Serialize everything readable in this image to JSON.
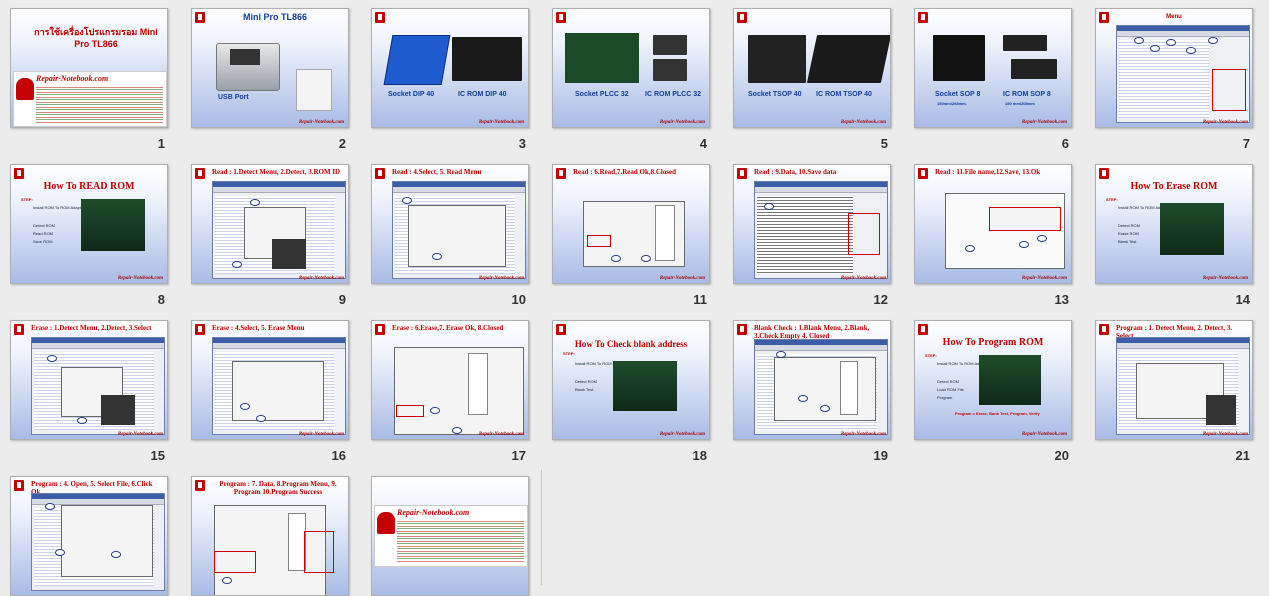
{
  "slides": [
    {
      "num": "1",
      "title_th": "การใช้เครื่องโปรแกรมรอม Mini Pro TL866",
      "site": "Repair-Notebook.com"
    },
    {
      "num": "2",
      "title": "Mini Pro TL866",
      "usb": "USB Port"
    },
    {
      "num": "3",
      "left": "Socket DIP 40",
      "right": "IC ROM DIP 40"
    },
    {
      "num": "4",
      "left": "Socket PLCC 32",
      "right": "IC ROM PLCC 32"
    },
    {
      "num": "5",
      "left": "Socket TSOP 40",
      "right": "IC ROM TSOP 40"
    },
    {
      "num": "6",
      "left": "Socket SOP 8",
      "right": "IC ROM SOP 8",
      "sub_left": "150mm/208mm.",
      "sub_right": "150 mm/208mm"
    },
    {
      "num": "7",
      "title": "Menu"
    },
    {
      "num": "8",
      "title": "How To READ  ROM",
      "step": "STEP:",
      "items": [
        "Install ROM To ROM Adapter",
        "Detect ROM",
        "Read ROM",
        "Save ROM"
      ]
    },
    {
      "num": "9",
      "title": "Read : 1.Detect Menu, 2.Detect, 3.ROM ID"
    },
    {
      "num": "10",
      "title": "Read : 4.Select, 5. Read Menu"
    },
    {
      "num": "11",
      "title": "Read : 6.Read,7.Read Ok,8.Closed"
    },
    {
      "num": "12",
      "title": "Read : 9.Data, 10.Save data"
    },
    {
      "num": "13",
      "title": "Read : 11.File name,12.Save, 13.Ok"
    },
    {
      "num": "14",
      "title": "How To Erase ROM",
      "step": "STEP:",
      "items": [
        "Install ROM To ROM Adapter",
        "Detect ROM",
        "Erase ROM",
        "Blank Test"
      ]
    },
    {
      "num": "15",
      "title": "Erase : 1.Detect Menu, 2.Detect, 3.Select"
    },
    {
      "num": "16",
      "title": "Erase : 4.Select, 5. Erase Menu"
    },
    {
      "num": "17",
      "title": "Erase : 6.Erase,7. Erase Ok, 8.Closed"
    },
    {
      "num": "18",
      "title": "How To Check blank address",
      "step": "STEP:",
      "items": [
        "Install ROM To ROM Adapter",
        "Detect ROM",
        "Blank Test"
      ]
    },
    {
      "num": "19",
      "title": "Blank Check : 1.Blank Menu, 2.Blank, 3.Check Empty 4. Closed"
    },
    {
      "num": "20",
      "title": "How To  Program ROM",
      "step": "STEP:",
      "items": [
        "Install ROM To ROM Adapter",
        "Detect ROM",
        "Load ROM File",
        "Program"
      ],
      "note": "Program = Erase, Bank Test, Program, Verify"
    },
    {
      "num": "21",
      "title": "Program : 1. Detect Menu, 2. Detect, 3. Select"
    },
    {
      "num": "22",
      "title": "Program : 4. Open, 5. Select File, 6.Click Ok"
    },
    {
      "num": "23",
      "title": "Program : 7. Data, 8.Program Menu, 9. Program 10.Program Success"
    },
    {
      "num": "",
      "site": "Repair-Notebook.com"
    }
  ],
  "footer": "Repair-Notebook.com",
  "colors": {
    "title_red": "#c00000",
    "title_blue": "#1040a0",
    "background": "#ececec"
  }
}
